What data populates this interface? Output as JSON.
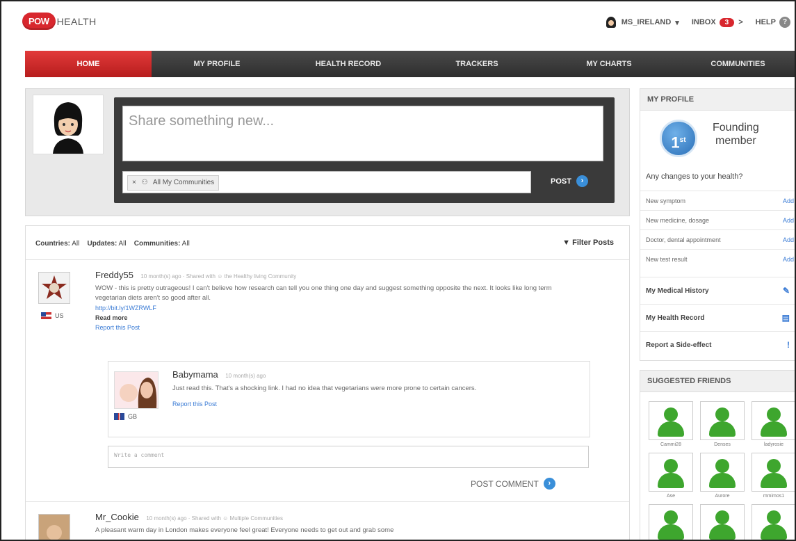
{
  "brand": {
    "badge": "POW",
    "name": "HEALTH"
  },
  "header": {
    "username": "MS_IRELAND",
    "user_caret": "▾",
    "inbox_label": "INBOX",
    "inbox_count": "3",
    "inbox_arrow": ">",
    "help_label": "HELP",
    "help_glyph": "?"
  },
  "nav": {
    "items": [
      {
        "label": "HOME",
        "active": true
      },
      {
        "label": "MY PROFILE"
      },
      {
        "label": "HEALTH RECORD"
      },
      {
        "label": "TRACKERS"
      },
      {
        "label": "MY CHARTS"
      },
      {
        "label": "COMMUNITIES"
      }
    ]
  },
  "composer": {
    "placeholder": "Share something new...",
    "community_chip": "All My Communities",
    "chip_remove": "×",
    "post_label": "POST",
    "arrow": "›"
  },
  "filters": {
    "countries_label": "Countries:",
    "countries_value": "All",
    "updates_label": "Updates:",
    "updates_value": "All",
    "communities_label": "Communities:",
    "communities_value": "All",
    "filter_posts": "Filter Posts"
  },
  "posts": [
    {
      "author": "Freddy55",
      "meta": "10 month(s) ago  ·  Shared with  ☺  the Healthy living Community",
      "text": "WOW - this is pretty outrageous! I can't believe how research can tell you one thing one day and suggest something opposite the next. It looks like long term vegetarian diets aren't so good after all.",
      "link": "http://bit.ly/1WZRWLF",
      "read_more": "Read more",
      "report": "Report this Post",
      "country": "US"
    },
    {
      "author": "Mr_Cookie",
      "meta": "10 month(s) ago  ·  Shared with  ☺  Multiple Communities",
      "text": "A pleasant warm day in London makes everyone feel great! Everyone needs to get out and grab some"
    }
  ],
  "reply": {
    "author": "Babymama",
    "meta": "10 month(s) ago",
    "text": "Just read this. That's a shocking link. I had no idea that vegetarians were more prone to certain cancers.",
    "country": "GB",
    "report": "Report this Post"
  },
  "comment": {
    "placeholder": "Write a comment",
    "post_label": "POST COMMENT",
    "arrow": "›"
  },
  "profile_panel": {
    "title": "MY PROFILE",
    "medal": "1",
    "medal_suffix": "st",
    "founding_line1": "Founding",
    "founding_line2": "member",
    "changes_title": "Any changes to your health?",
    "rows": [
      {
        "label": "New symptom",
        "action": "Add"
      },
      {
        "label": "New medicine, dosage",
        "action": "Add"
      },
      {
        "label": "Doctor, dental appointment",
        "action": "Add"
      },
      {
        "label": "New test result",
        "action": "Add"
      }
    ],
    "links": [
      {
        "label": "My Medical History",
        "icon": "✎"
      },
      {
        "label": "My Health Record",
        "icon": "▤"
      },
      {
        "label": "Report a Side-effect",
        "icon": "!"
      }
    ]
  },
  "friends_panel": {
    "title": "SUGGESTED FRIENDS",
    "friends": [
      "Cammi28",
      "Denses",
      "ladyrosie",
      "Ase",
      "Aurore",
      "mmimos1"
    ]
  },
  "colors": {
    "brand_red": "#d8272e",
    "nav_dark": "#333333",
    "link_blue": "#3a7bd5",
    "friend_green": "#3ea62e"
  }
}
